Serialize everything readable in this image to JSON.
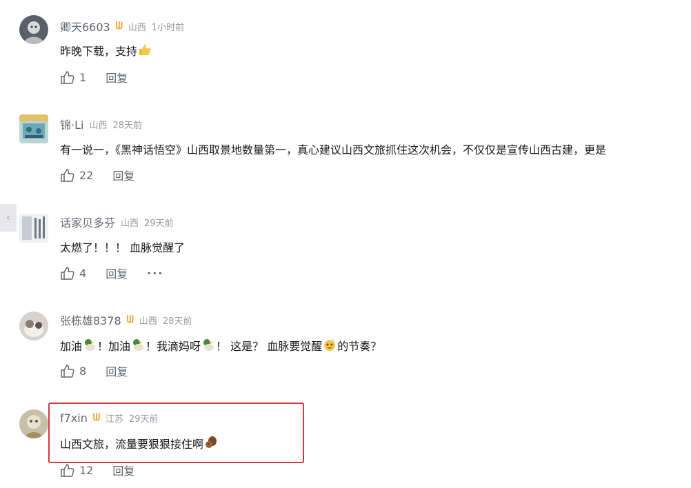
{
  "comments": [
    {
      "username": "卿天6603",
      "has_badge": true,
      "badge": "ᗯ",
      "location": "山西",
      "time": "1小时前",
      "text": "昨晚下载，支持",
      "likes": "1",
      "reply_label": "回复"
    },
    {
      "username": "锦·Li",
      "has_badge": false,
      "location": "山西",
      "time": "28天前",
      "text": "有一说一，《黑神话悟空》山西取景地数量第一，真心建议山西文旅抓住这次机会，不仅仅是宣传山西古建，更是",
      "likes": "22",
      "reply_label": "回复"
    },
    {
      "username": "话家贝多芬",
      "has_badge": false,
      "location": "山西",
      "time": "29天前",
      "text": "太燃了！！！ 血脉觉醒了",
      "likes": "4",
      "reply_label": "回复",
      "more_label": "···"
    },
    {
      "username": "张栋雄8378",
      "has_badge": true,
      "badge": "ᗯ",
      "location": "山西",
      "time": "28天前",
      "text_parts": [
        "加油",
        "！加油",
        "！我滴妈呀",
        "！ 这是？ 血脉要觉醒",
        "的节奏？"
      ],
      "likes": "8",
      "reply_label": "回复"
    },
    {
      "username": "f7xin",
      "has_badge": true,
      "badge": "ᗯ",
      "location": "江苏",
      "time": "29天前",
      "text": "山西文旅，流量要狠狠接住啊",
      "likes": "12",
      "reply_label": "回复"
    }
  ],
  "colors": {
    "highlight": "#d9363e",
    "badge": "#f0a020",
    "meta": "#9499a0",
    "username": "#61666d"
  },
  "icons": {
    "like": "thumb-up-icon",
    "left_handle": "chevron-left-icon"
  }
}
